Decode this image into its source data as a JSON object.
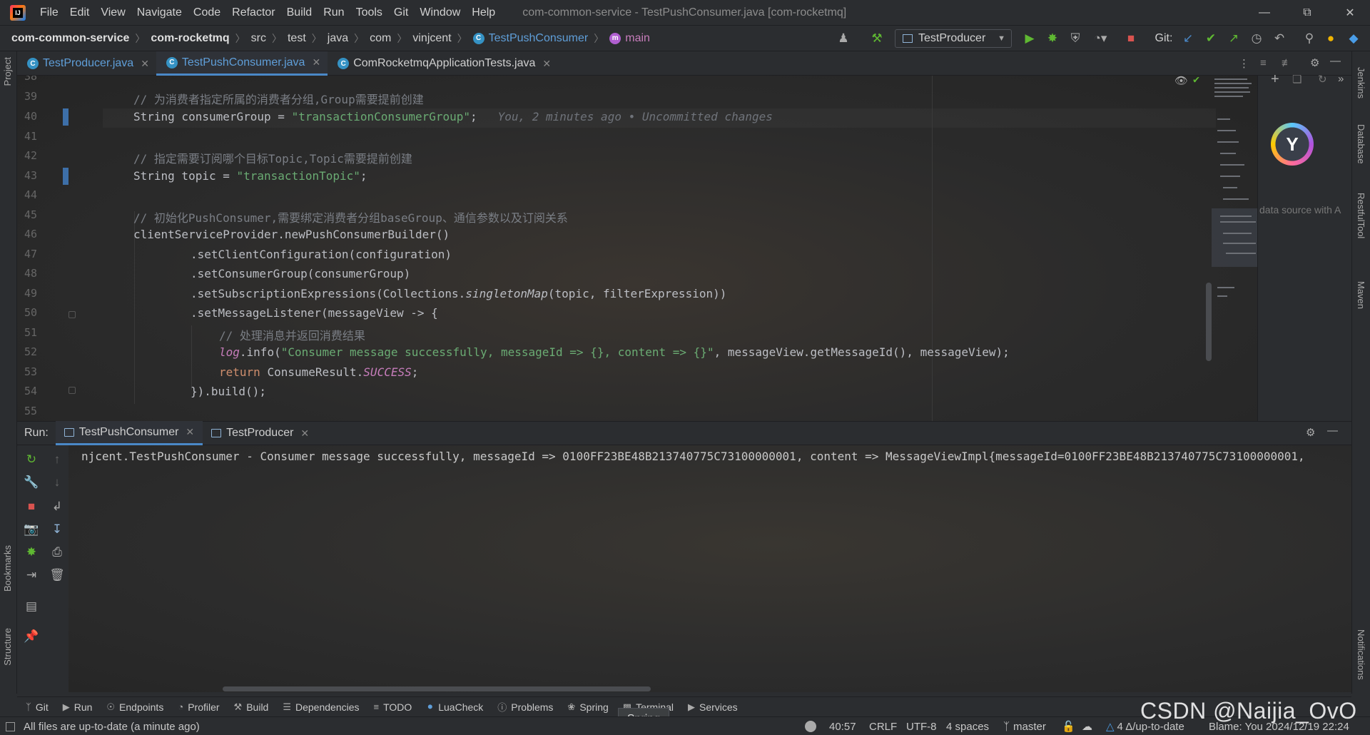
{
  "menu": {
    "items": [
      "File",
      "Edit",
      "View",
      "Navigate",
      "Code",
      "Refactor",
      "Build",
      "Run",
      "Tools",
      "Git",
      "Window",
      "Help"
    ],
    "window_title": "com-common-service - TestPushConsumer.java [com-rocketmq]"
  },
  "breadcrumb": {
    "items": [
      "com-common-service",
      "com-rocketmq",
      "src",
      "test",
      "java",
      "com",
      "vinjcent",
      "TestPushConsumer",
      "main"
    ]
  },
  "toolbar": {
    "run_config": "TestProducer",
    "git_label": "Git:"
  },
  "tabs": [
    {
      "label": "TestProducer.java"
    },
    {
      "label": "TestPushConsumer.java"
    },
    {
      "label": "ComRocketmqApplicationTests.java"
    }
  ],
  "editor": {
    "line_numbers": [
      "38",
      "39",
      "40",
      "41",
      "42",
      "43",
      "44",
      "45",
      "46",
      "47",
      "48",
      "49",
      "50",
      "51",
      "52",
      "53",
      "54",
      "55"
    ],
    "comment_39": "// 为消费者指定所属的消费者分组,Group需要提前创建",
    "l40_a": "String consumerGroup = ",
    "l40_str": "\"transactionConsumerGroup\"",
    "l40_end": ";",
    "blame": "You, 2 minutes ago • Uncommitted changes",
    "comment_42": "// 指定需要订阅哪个目标Topic,Topic需要提前创建",
    "l43_a": "String topic = ",
    "l43_str": "\"transactionTopic\"",
    "l43_end": ";",
    "comment_45": "// 初始化PushConsumer,需要绑定消费者分组baseGroup、通信参数以及订阅关系",
    "l46": "clientServiceProvider.newPushConsumerBuilder()",
    "l47": ".setClientConfiguration(configuration)",
    "l48": ".setConsumerGroup(consumerGroup)",
    "l49_a": ".setSubscriptionExpressions(Collections.",
    "l49_it": "singletonMap",
    "l49_b": "(topic, filterExpression))",
    "l50": ".setMessageListener(messageView -> {",
    "comment_51": "// 处理消息并返回消费结果",
    "l52_log": "log",
    "l52_a": ".info(",
    "l52_str": "\"Consumer message successfully, messageId => {}, content => {}\"",
    "l52_b": ", messageView.getMessageId(), messageView);",
    "l53_kw": "return ",
    "l53_a": "ConsumeResult.",
    "l53_const": "SUCCESS",
    "l53_end": ";",
    "l54": "}).build();"
  },
  "side_panel": {
    "hint": "data source with A"
  },
  "right_stripe": [
    "Jenkins",
    "Database",
    "RestfulTool",
    "Maven",
    "Notifications"
  ],
  "left_stripe": [
    "Project",
    "Bookmarks",
    "Structure"
  ],
  "run": {
    "label": "Run:",
    "tabs": [
      {
        "label": "TestPushConsumer"
      },
      {
        "label": "TestProducer"
      }
    ],
    "console_line": "njcent.TestPushConsumer - Consumer message successfully, messageId => 0100FF23BE48B213740775C73100000001, content => MessageViewImpl{messageId=0100FF23BE48B213740775C73100000001,"
  },
  "tool_windows": [
    "Git",
    "Run",
    "Endpoints",
    "Profiler",
    "Build",
    "Dependencies",
    "TODO",
    "LuaCheck",
    "Problems",
    "Spring",
    "Terminal",
    "Services"
  ],
  "tooltip": "Spring",
  "status": {
    "message": "All files are up-to-date (a minute ago)",
    "position": "40:57",
    "line_sep": "CRLF",
    "encoding": "UTF-8",
    "indent": "4 spaces",
    "branch": "master",
    "vcs": "4 Δ/up-to-date",
    "blame": "Blame: You 2024/12/19 22:24"
  },
  "watermark": "CSDN @Naijia_OvO"
}
